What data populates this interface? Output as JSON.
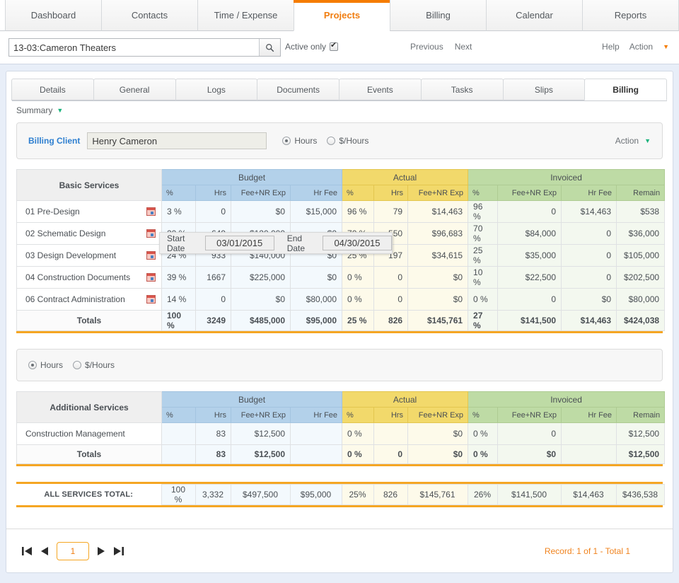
{
  "top_tabs": [
    {
      "label": "Dashboard",
      "active": false
    },
    {
      "label": "Contacts",
      "active": false
    },
    {
      "label": "Time / Expense",
      "active": false
    },
    {
      "label": "Projects",
      "active": true
    },
    {
      "label": "Billing",
      "active": false
    },
    {
      "label": "Calendar",
      "active": false
    },
    {
      "label": "Reports",
      "active": false
    }
  ],
  "toolbar": {
    "search_value": "13-03:Cameron Theaters",
    "search_placeholder": "",
    "search_icon": "search-icon",
    "active_only_label": "Active only",
    "active_only_checked": true,
    "previous_label": "Previous",
    "next_label": "Next",
    "help_label": "Help",
    "action_label": "Action"
  },
  "sub_tabs": [
    {
      "label": "Details",
      "active": false
    },
    {
      "label": "General",
      "active": false
    },
    {
      "label": "Logs",
      "active": false
    },
    {
      "label": "Documents",
      "active": false
    },
    {
      "label": "Events",
      "active": false
    },
    {
      "label": "Tasks",
      "active": false
    },
    {
      "label": "Slips",
      "active": false
    },
    {
      "label": "Billing",
      "active": true
    }
  ],
  "summary": {
    "label": "Summary"
  },
  "client_panel": {
    "billing_client_label": "Billing Client",
    "billing_client_value": "Henry Cameron",
    "radio_hours": "Hours",
    "radio_dollar_hours": "$/Hours",
    "selected": "Hours",
    "action_label": "Action"
  },
  "mid_radios": {
    "radio_hours": "Hours",
    "radio_dollar_hours": "$/Hours",
    "selected": "Hours"
  },
  "colors": {
    "accent_orange": "#f57c00",
    "budget_blue": "#b3d1ea",
    "actual_yellow": "#f2d96b",
    "invoiced_green": "#bedba5",
    "budget_cell": "#f3f9fd",
    "actual_cell": "#fdfaea",
    "invoiced_cell": "#f3f8ef",
    "record_orange": "#f0831e"
  },
  "basic_table": {
    "name_header": "Basic Services",
    "groups": [
      {
        "label": "Budget",
        "span": 4
      },
      {
        "label": "Actual",
        "span": 3
      },
      {
        "label": "Invoiced",
        "span": 4
      }
    ],
    "columns": [
      "%",
      "Hrs",
      "Fee+NR Exp",
      "Hr Fee",
      "%",
      "Hrs",
      "Fee+NR Exp",
      "%",
      "Fee+NR Exp",
      "Hr Fee",
      "Remain"
    ],
    "rows": [
      {
        "name": "01 Pre-Design",
        "icon": "calendar-icon",
        "cells": [
          "3 %",
          "0",
          "$0",
          "$15,000",
          "96 %",
          "79",
          "$14,463",
          "96 %",
          "0",
          "$14,463",
          "$538"
        ]
      },
      {
        "name": "02 Schematic Design",
        "icon": "calendar-icon",
        "cells": [
          "20 %",
          "649",
          "$120,000",
          "$0",
          "70 %",
          "550",
          "$96,683",
          "70 %",
          "$84,000",
          "0",
          "$36,000"
        ]
      },
      {
        "name": "03 Design Development",
        "icon": "calendar-icon",
        "cells": [
          "24 %",
          "933",
          "$140,000",
          "$0",
          "25 %",
          "197",
          "$34,615",
          "25 %",
          "$35,000",
          "0",
          "$105,000"
        ]
      },
      {
        "name": "04 Construction Documents",
        "icon": "calendar-icon",
        "cells": [
          "39 %",
          "1667",
          "$225,000",
          "$0",
          "0 %",
          "0",
          "$0",
          "10 %",
          "$22,500",
          "0",
          "$202,500"
        ]
      },
      {
        "name": "06 Contract Administration",
        "icon": "calendar-icon",
        "cells": [
          "14 %",
          "0",
          "$0",
          "$80,000",
          "0 %",
          "0",
          "$0",
          "0 %",
          "0",
          "$0",
          "$80,000"
        ]
      }
    ],
    "totals": {
      "name": "Totals",
      "cells": [
        "100 %",
        "3249",
        "$485,000",
        "$95,000",
        "25 %",
        "826",
        "$145,761",
        "27 %",
        "$141,500",
        "$14,463",
        "$424,038"
      ]
    }
  },
  "additional_table": {
    "name_header": "Additional Services",
    "groups": [
      {
        "label": "Budget",
        "span": 4
      },
      {
        "label": "Actual",
        "span": 3
      },
      {
        "label": "Invoiced",
        "span": 4
      }
    ],
    "columns": [
      "%",
      "Hrs",
      "Fee+NR Exp",
      "Hr Fee",
      "%",
      "Hrs",
      "Fee+NR Exp",
      "%",
      "Fee+NR Exp",
      "Hr Fee",
      "Remain"
    ],
    "rows": [
      {
        "name": "Construction Management",
        "cells": [
          "",
          "83",
          "$12,500",
          "",
          "0 %",
          "",
          "$0",
          "0 %",
          "0",
          "",
          "$12,500"
        ]
      }
    ],
    "totals": {
      "name": "Totals",
      "cells": [
        "",
        "83",
        "$12,500",
        "",
        "0 %",
        "0",
        "$0",
        "0 %",
        "$0",
        "",
        "$12,500"
      ]
    }
  },
  "all_services_total": {
    "label": "ALL SERVICES TOTAL:",
    "cells": [
      "100 %",
      "3,332",
      "$497,500",
      "$95,000",
      "25%",
      "826",
      "$145,761",
      "26%",
      "$141,500",
      "$14,463",
      "$436,538"
    ]
  },
  "date_popup": {
    "start_label": "Start Date",
    "start_value": "03/01/2015",
    "end_label": "End Date",
    "end_value": "04/30/2015"
  },
  "footer": {
    "first_icon": "first-page-icon",
    "prev_icon": "previous-page-icon",
    "page_value": "1",
    "next_icon": "next-page-icon",
    "last_icon": "last-page-icon",
    "record_info": "Record: 1 of 1 - Total 1"
  }
}
